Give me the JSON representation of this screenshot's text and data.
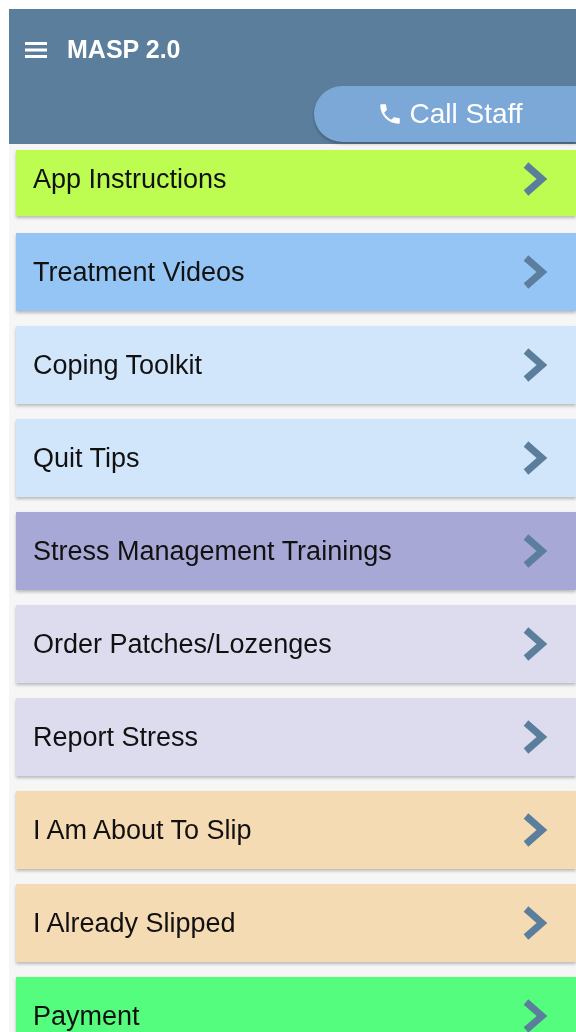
{
  "header": {
    "title": "MASP 2.0",
    "call_button": "Call Staff"
  },
  "menu": [
    {
      "label": "App Instructions",
      "color": "#bdfc50"
    },
    {
      "label": "Treatment Videos",
      "color": "#94c5f5"
    },
    {
      "label": "Coping Toolkit",
      "color": "#d2e6fb"
    },
    {
      "label": "Quit Tips",
      "color": "#d2e6fb"
    },
    {
      "label": "Stress Management Trainings",
      "color": "#a8a8d6"
    },
    {
      "label": "Order Patches/Lozenges",
      "color": "#dcdcee"
    },
    {
      "label": "Report Stress",
      "color": "#dcdcee"
    },
    {
      "label": "I Am About To Slip",
      "color": "#f5dbb3"
    },
    {
      "label": "I Already Slipped",
      "color": "#f5dbb3"
    },
    {
      "label": "Payment",
      "color": "#55fd7e"
    }
  ]
}
